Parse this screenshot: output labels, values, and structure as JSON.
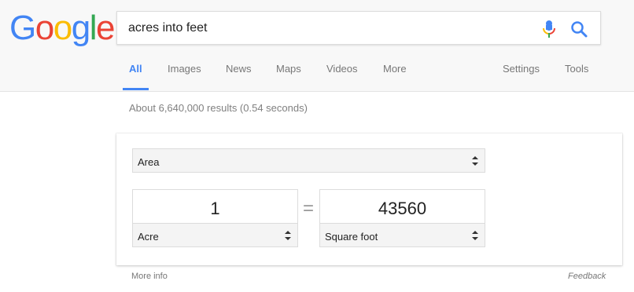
{
  "logo": {
    "letters": [
      "G",
      "o",
      "o",
      "g",
      "l",
      "e"
    ],
    "colors": [
      "#4285f4",
      "#ea4335",
      "#fbbc05",
      "#4285f4",
      "#34a853",
      "#ea4335"
    ]
  },
  "search": {
    "query": "acres into feet"
  },
  "tabs": {
    "all": "All",
    "images": "Images",
    "news": "News",
    "maps": "Maps",
    "videos": "Videos",
    "more": "More",
    "settings": "Settings",
    "tools": "Tools"
  },
  "results": {
    "stats": "About 6,640,000 results (0.54 seconds)"
  },
  "converter": {
    "category": "Area",
    "from_value": "1",
    "from_unit": "Acre",
    "equals": "=",
    "to_value": "43560",
    "to_unit": "Square foot"
  },
  "footer": {
    "more_info": "More info",
    "feedback": "Feedback"
  },
  "colors": {
    "accent": "#4285f4",
    "mic_red": "#ea4335",
    "mic_yellow": "#fbbc05",
    "mic_green": "#34a853"
  },
  "icons": {
    "mic": "microphone-icon",
    "search": "search-icon",
    "select_arrows": "up-down-arrows-icon"
  }
}
